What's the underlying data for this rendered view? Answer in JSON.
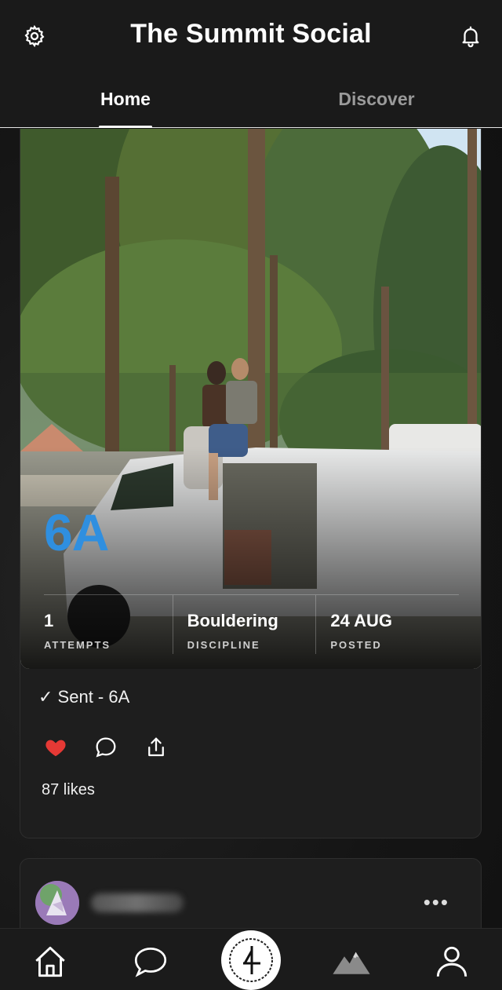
{
  "header": {
    "title": "The Summit Social",
    "settings_icon": "gear-icon",
    "notifications_icon": "bell-icon"
  },
  "tabs": [
    {
      "label": "Home",
      "active": true
    },
    {
      "label": "Discover",
      "active": false
    }
  ],
  "post": {
    "grade": "6A",
    "stats": [
      {
        "value": "1",
        "label": "ATTEMPTS"
      },
      {
        "value": "Bouldering",
        "label": "DISCIPLINE"
      },
      {
        "value": "24 AUG",
        "label": "POSTED"
      }
    ],
    "caption": "✓ Sent  - 6A",
    "likes": "87 likes",
    "liked": true,
    "colors": {
      "grade": "#2f8fe0",
      "like": "#e53935"
    }
  },
  "next_post": {
    "more_label": "•••"
  },
  "bottom_nav": [
    {
      "icon": "home-icon"
    },
    {
      "icon": "chat-icon"
    },
    {
      "icon": "log-climb-icon"
    },
    {
      "icon": "mountains-icon"
    },
    {
      "icon": "profile-icon"
    }
  ]
}
